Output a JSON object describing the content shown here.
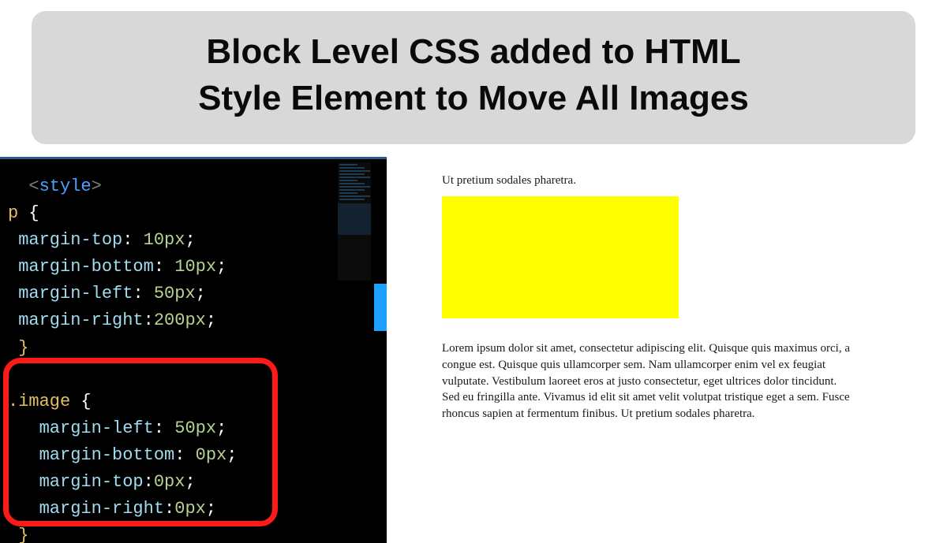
{
  "title": {
    "line1": "Block Level CSS added to HTML",
    "line2": "Style Element to Move All Images"
  },
  "editor": {
    "style_open_lt": "<",
    "style_open_tag": "style",
    "style_open_gt": ">",
    "p_selector": "p ",
    "brace_open": "{",
    "brace_close": "}",
    "rule1_prop": "margin-top",
    "rule1_val": "10px",
    "rule2_prop": "margin-bottom",
    "rule2_val": "10px",
    "rule3_prop": "margin-left",
    "rule3_val": "50px",
    "rule4_prop": "margin-right",
    "rule4_val": "200px",
    "image_selector": ".image ",
    "img1_prop": "margin-left",
    "img1_val": "50px",
    "img2_prop": "margin-bottom",
    "img2_val": "0px",
    "img3_prop": "margin-top",
    "img3_val": "0px",
    "img4_prop": "margin-right",
    "img4_val": "0px",
    "colon": ": ",
    "colon_tight": ":",
    "semi": ";"
  },
  "preview": {
    "top_fragment": "Ut pretium sodales pharetra.",
    "paragraph": "Lorem ipsum dolor sit amet, consectetur adipiscing elit. Quisque quis maximus orci, a congue est. Quisque quis ullamcorper sem. Nam ullamcorper enim vel ex feugiat vulputate. Vestibulum laoreet eros at justo consectetur, eget ultrices dolor tincidunt. Sed eu fringilla ante. Vivamus id elit sit amet velit volutpat tristique eget a sem. Fusce rhoncus sapien at fermentum finibus. Ut pretium sodales pharetra."
  }
}
